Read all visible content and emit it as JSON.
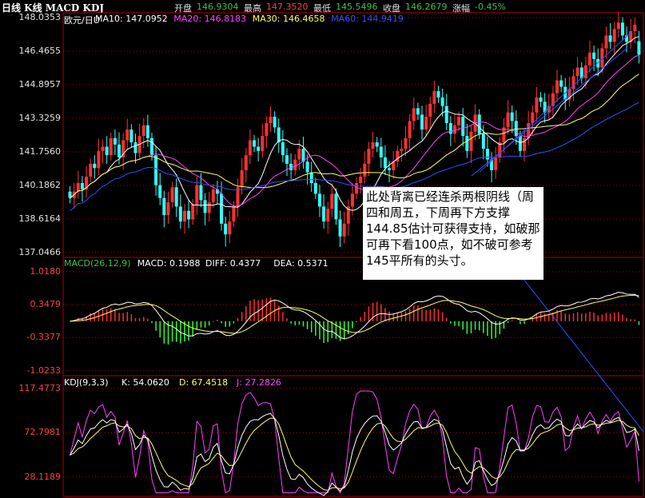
{
  "header": {
    "title": "日线 K线 MACD KDJ",
    "quote": [
      {
        "label": "开盘",
        "value": "146.9304",
        "color": "#40c040"
      },
      {
        "label": "最高",
        "value": "147.3520",
        "color": "#ff4040"
      },
      {
        "label": "最低",
        "value": "145.5496",
        "color": "#40c040"
      },
      {
        "label": "收盘",
        "value": "146.2679",
        "color": "#40c040"
      },
      {
        "label": "涨幅",
        "value": "-0.45%",
        "color": "#40c040"
      }
    ]
  },
  "main_legend": [
    {
      "text": "欧元/日U",
      "color": "#ffffff"
    },
    {
      "text": "MA10: 147.0952",
      "color": "#ffffff"
    },
    {
      "text": "MA20: 146.8183",
      "color": "#ff40ff"
    },
    {
      "text": "MA30: 146.4658",
      "color": "#ffff60"
    },
    {
      "text": "MA60: 144.9419",
      "color": "#3050ff"
    }
  ],
  "macd_legend": [
    {
      "text": "MACD(26,12,9)",
      "color": "#40c040"
    },
    {
      "text": "MACD: 0.1988",
      "color": "#ffffff"
    },
    {
      "text": "DIFF: 0.4377",
      "color": "#ffffff"
    },
    {
      "text": "DEA: 0.5371",
      "color": "#ffffff"
    }
  ],
  "kdj_legend": [
    {
      "text": "KDJ(9,3,3)",
      "color": "#ffffff"
    },
    {
      "text": "K: 54.0620",
      "color": "#ffffff"
    },
    {
      "text": "D: 67.4518",
      "color": "#ffff60"
    },
    {
      "text": "J: 27.2826",
      "color": "#ff40ff"
    }
  ],
  "annotation": "此处背离已经连杀两根阴线（周四和周五，下周再下方支撑144.85估计可获得支持，如破那可再下看100点，如不破可参考145平所有的头寸。",
  "colors": {
    "up": "#ff3030",
    "down": "#30ffff",
    "grid": "#b00000",
    "ma10": "#ffffff",
    "ma20": "#ff40ff",
    "ma30": "#ffff60",
    "ma60": "#3050ff"
  },
  "chart_data": [
    {
      "type": "candlestick",
      "title": "",
      "yticks": [
        "148.0353",
        "146.4655",
        "144.8957",
        "143.3259",
        "141.7560",
        "140.1862",
        "138.6164",
        "137.0466"
      ],
      "ylim": [
        137.0466,
        148.0353
      ],
      "last_candle": {
        "open": 146.9304,
        "high": 147.352,
        "low": 145.5496,
        "close": 146.2679
      },
      "close": [
        139.6,
        139.9,
        140.3,
        140.0,
        140.6,
        141.2,
        141.0,
        141.8,
        142.0,
        141.6,
        142.4,
        142.1,
        141.5,
        142.3,
        142.8,
        142.2,
        141.7,
        142.5,
        143.0,
        142.4,
        141.6,
        140.2,
        139.6,
        138.8,
        139.4,
        140.1,
        139.2,
        138.5,
        139.0,
        138.6,
        139.3,
        140.2,
        139.5,
        138.9,
        139.4,
        140.0,
        139.8,
        138.4,
        137.9,
        138.5,
        139.2,
        140.1,
        140.9,
        141.6,
        142.3,
        142.0,
        141.8,
        142.5,
        143.1,
        143.4,
        142.9,
        142.2,
        141.6,
        141.2,
        140.9,
        141.4,
        141.9,
        141.3,
        140.8,
        140.3,
        139.8,
        139.2,
        138.5,
        139.1,
        139.8,
        138.6,
        137.8,
        138.4,
        139.2,
        139.8,
        140.3,
        140.6,
        141.2,
        141.9,
        142.2,
        142.0,
        141.5,
        141.0,
        140.9,
        141.3,
        141.8,
        141.9,
        142.4,
        143.2,
        143.8,
        143.5,
        142.8,
        143.4,
        144.0,
        144.6,
        144.3,
        143.9,
        143.1,
        142.6,
        143.0,
        143.4,
        142.5,
        141.8,
        142.7,
        143.5,
        142.6,
        141.9,
        141.4,
        140.9,
        141.5,
        142.2,
        142.9,
        143.6,
        143.2,
        142.5,
        141.8,
        142.4,
        143.1,
        143.6,
        144.3,
        144.1,
        143.6,
        143.9,
        144.5,
        145.1,
        144.8,
        144.2,
        144.7,
        145.3,
        145.7,
        145.2,
        145.8,
        146.4,
        146.1,
        145.7,
        146.6,
        147.2,
        146.9,
        147.5,
        147.8,
        147.2,
        146.9,
        147.4,
        147.7,
        146.3
      ],
      "open": [
        139.9,
        139.6,
        139.9,
        140.3,
        140.0,
        140.6,
        141.2,
        141.0,
        141.8,
        142.0,
        141.6,
        142.4,
        142.1,
        141.5,
        142.3,
        142.8,
        142.2,
        141.7,
        142.5,
        143.0,
        142.4,
        141.6,
        140.2,
        139.6,
        138.8,
        139.4,
        140.1,
        139.2,
        138.5,
        139.0,
        138.6,
        139.3,
        140.2,
        139.5,
        138.9,
        139.4,
        140.0,
        139.8,
        138.4,
        137.9,
        138.5,
        139.2,
        140.1,
        140.9,
        141.6,
        142.3,
        142.0,
        141.8,
        142.5,
        143.1,
        143.4,
        142.9,
        142.2,
        141.6,
        141.2,
        140.9,
        141.4,
        141.9,
        141.3,
        140.8,
        140.3,
        139.8,
        139.2,
        138.5,
        139.1,
        139.8,
        138.6,
        137.8,
        138.4,
        139.2,
        139.8,
        140.3,
        140.6,
        141.2,
        141.9,
        142.2,
        142.0,
        141.5,
        141.0,
        140.9,
        141.3,
        141.8,
        141.9,
        142.4,
        143.2,
        143.8,
        143.5,
        142.8,
        143.4,
        144.0,
        144.6,
        144.3,
        143.9,
        143.1,
        142.6,
        143.0,
        143.4,
        142.5,
        141.8,
        142.7,
        143.5,
        142.6,
        141.9,
        141.4,
        140.9,
        141.5,
        142.2,
        142.9,
        143.6,
        143.2,
        142.5,
        141.8,
        142.4,
        143.1,
        143.6,
        144.3,
        144.1,
        143.6,
        143.9,
        144.5,
        145.1,
        144.8,
        144.2,
        144.7,
        145.3,
        145.7,
        145.2,
        145.8,
        146.4,
        146.1,
        145.7,
        146.6,
        147.2,
        146.9,
        147.5,
        147.8,
        147.2,
        146.9,
        147.4,
        146.93
      ]
    },
    {
      "type": "line",
      "title": "MACD(26,12,9)",
      "yticks": [
        "1.0180",
        "0.3479",
        "-0.3377",
        "-1.0233"
      ],
      "ylim": [
        -1.0233,
        1.018
      ],
      "last": {
        "MACD": 0.1988,
        "DIFF": 0.4377,
        "DEA": 0.5371
      }
    },
    {
      "type": "line",
      "title": "KDJ(9,3,3)",
      "yticks": [
        "117.4773",
        "72.7981",
        "28.1189"
      ],
      "ylim": [
        10,
        117.4773
      ],
      "last": {
        "K": 54.062,
        "D": 67.4518,
        "J": 27.2826
      }
    }
  ]
}
